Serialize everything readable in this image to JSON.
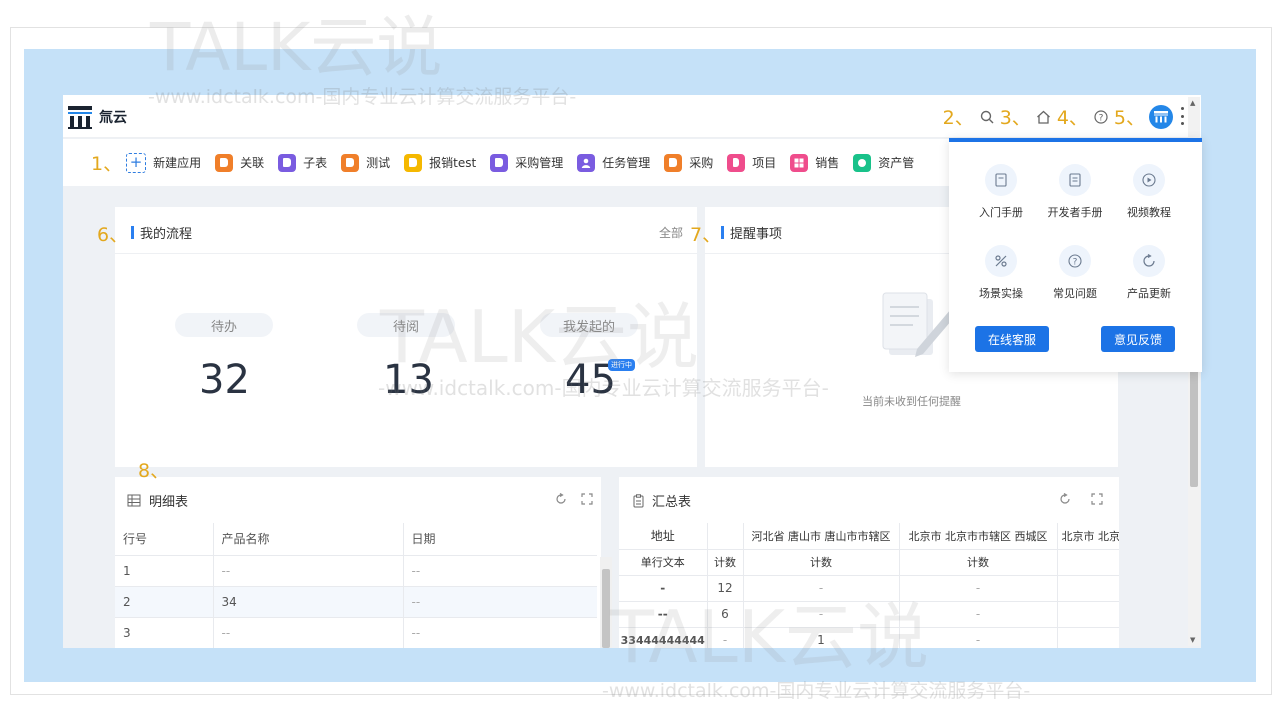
{
  "brand": {
    "name": "氚云"
  },
  "annotations": [
    "1、",
    "2、",
    "3、",
    "4、",
    "5、",
    "6、",
    "7、",
    "8、"
  ],
  "apps": [
    {
      "label": "新建应用",
      "color": ""
    },
    {
      "label": "关联",
      "color": "#f07f2a"
    },
    {
      "label": "子表",
      "color": "#7a5ce0"
    },
    {
      "label": "测试",
      "color": "#f07f2a"
    },
    {
      "label": "报销test",
      "color": "#f5b800"
    },
    {
      "label": "采购管理",
      "color": "#7a5ce0"
    },
    {
      "label": "任务管理",
      "color": "#7a5ce0"
    },
    {
      "label": "采购",
      "color": "#f07f2a"
    },
    {
      "label": "项目",
      "color": "#ef4d8c"
    },
    {
      "label": "销售",
      "color": "#ef4d8c"
    },
    {
      "label": "资产管",
      "color": "#19c28a"
    }
  ],
  "my_flow": {
    "title": "我的流程",
    "all_link": "全部",
    "stats": [
      {
        "label": "待办",
        "value": "32"
      },
      {
        "label": "待阅",
        "value": "13"
      },
      {
        "label": "我发起的",
        "value": "45",
        "badge": "进行中"
      }
    ]
  },
  "reminders": {
    "title": "提醒事项",
    "empty_text": "当前未收到任何提醒"
  },
  "detail_table": {
    "title": "明细表",
    "columns": [
      "行号",
      "产品名称",
      "日期"
    ],
    "rows": [
      [
        "1",
        "--",
        "--"
      ],
      [
        "2",
        "34",
        "--"
      ],
      [
        "3",
        "--",
        "--"
      ]
    ]
  },
  "summary_table": {
    "title": "汇总表",
    "header_row1": [
      "地址",
      "",
      "河北省 唐山市 唐山市市辖区",
      "北京市 北京市市辖区 西城区",
      "北京市 北京"
    ],
    "header_row2": [
      "单行文本",
      "计数",
      "计数",
      "计数",
      ""
    ],
    "rows": [
      [
        "-",
        "12",
        "-",
        "-",
        ""
      ],
      [
        "--",
        "6",
        "-",
        "-",
        ""
      ],
      [
        "33444444444",
        "-",
        "1",
        "-",
        ""
      ]
    ]
  },
  "help_popup": {
    "items": [
      {
        "label": "入门手册",
        "icon": "book-icon"
      },
      {
        "label": "开发者手册",
        "icon": "dev-book-icon"
      },
      {
        "label": "视频教程",
        "icon": "play-icon"
      },
      {
        "label": "场景实操",
        "icon": "percent-icon"
      },
      {
        "label": "常见问题",
        "icon": "question-icon"
      },
      {
        "label": "产品更新",
        "icon": "refresh-icon"
      }
    ],
    "online_service": "在线客服",
    "feedback": "意见反馈"
  },
  "watermark": {
    "logo_text": "TALK云说",
    "url_text": "-www.idctalk.com-国内专业云计算交流服务平台-"
  },
  "colors": {
    "primary": "#1c73e6",
    "accent_annotation": "#e3a81e",
    "backdrop": "#c5e1f8"
  }
}
